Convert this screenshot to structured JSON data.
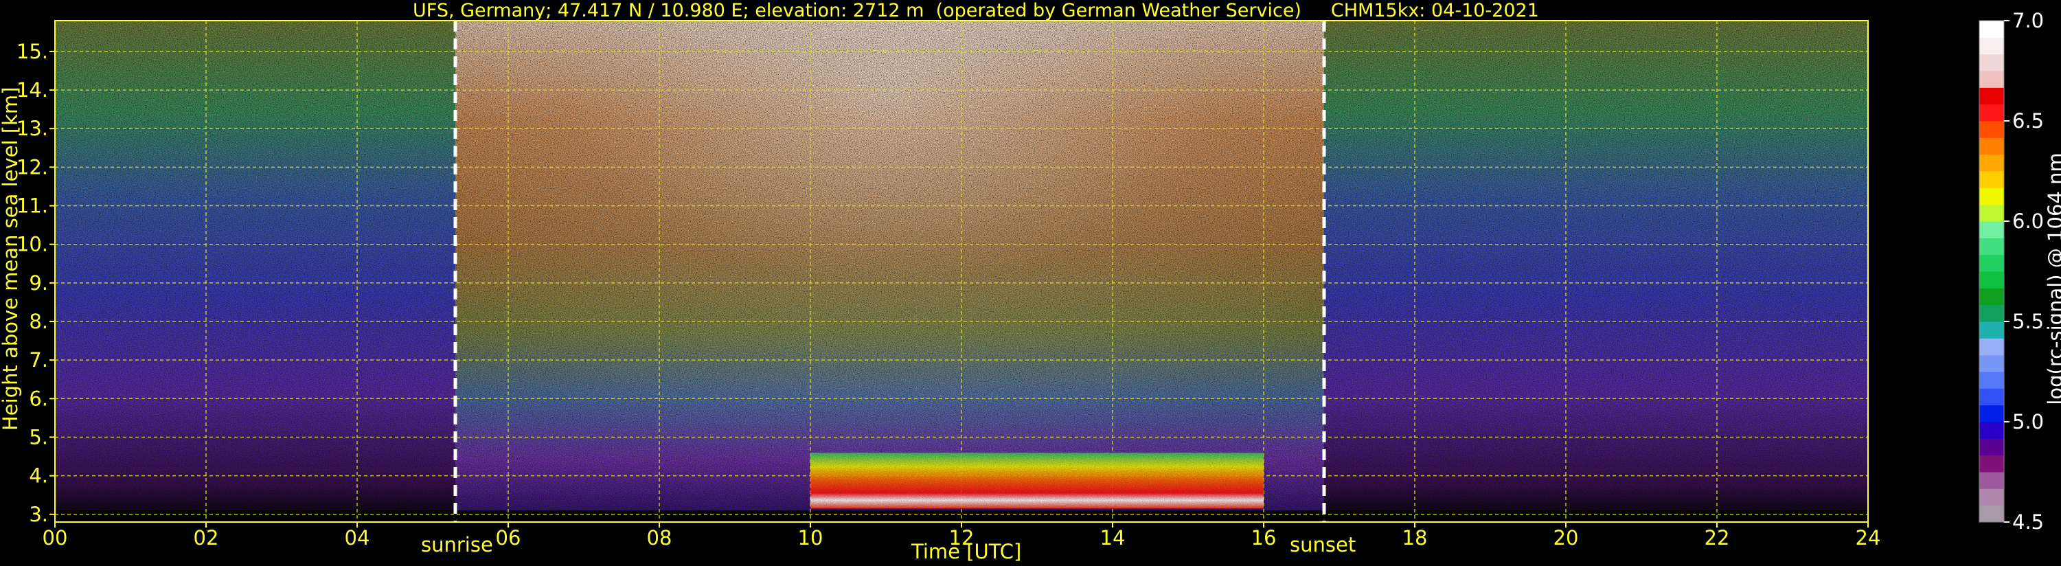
{
  "chart_data": {
    "type": "heatmap",
    "title": "UFS, Germany; 47.417 N / 10.980 E; elevation: 2712 m  (operated by German Weather Service)     CHM15kx: 04-10-2021",
    "xlabel": "Time [UTC]",
    "ylabel": "Height above mean sea level [km]",
    "xlim": [
      0,
      24
    ],
    "ylim": [
      2.8,
      15.8
    ],
    "x_tick_labels": [
      "00",
      "02",
      "04",
      "06",
      "08",
      "10",
      "12",
      "14",
      "16",
      "18",
      "20",
      "22",
      "24"
    ],
    "y_tick_labels": [
      "3.",
      "4.",
      "5.",
      "6.",
      "7.",
      "8.",
      "9.",
      "10.",
      "11.",
      "12.",
      "13.",
      "14.",
      "15."
    ],
    "grid": true,
    "events": [
      {
        "label": "sunrise",
        "time": 5.3
      },
      {
        "label": "sunset",
        "time": 16.8
      }
    ],
    "cloud_layers": [
      {
        "t_start": 10.0,
        "t_end": 16.0,
        "h_base": 3.15,
        "h_top": 4.6,
        "peak_value": 7.0
      }
    ],
    "colorbar": {
      "label": "log(rc-signal) @ 1064 nm",
      "range": [
        4.5,
        7.0
      ],
      "tick_labels": [
        "7.0",
        "6.5",
        "6.0",
        "5.5",
        "5.0",
        "4.5"
      ],
      "colors": [
        "#a89aa8",
        "#b088b0",
        "#9e5a9e",
        "#80107a",
        "#5a0090",
        "#2800c8",
        "#0020e8",
        "#3050f8",
        "#5578f8",
        "#7898f8",
        "#98b0f8",
        "#20b0b0",
        "#10a060",
        "#10a020",
        "#10c040",
        "#20d060",
        "#40e080",
        "#70f0a0",
        "#c0f830",
        "#f0f800",
        "#ffd000",
        "#ffa800",
        "#ff8000",
        "#ff5000",
        "#ff1818",
        "#e80000",
        "#f0c0c0",
        "#f0d8d8",
        "#f8f0f0",
        "#ffffff"
      ]
    },
    "colors": {
      "axis": "#ffff33",
      "grid": "#dddd22",
      "event_line": "#ffffff",
      "background": "#000000"
    }
  }
}
